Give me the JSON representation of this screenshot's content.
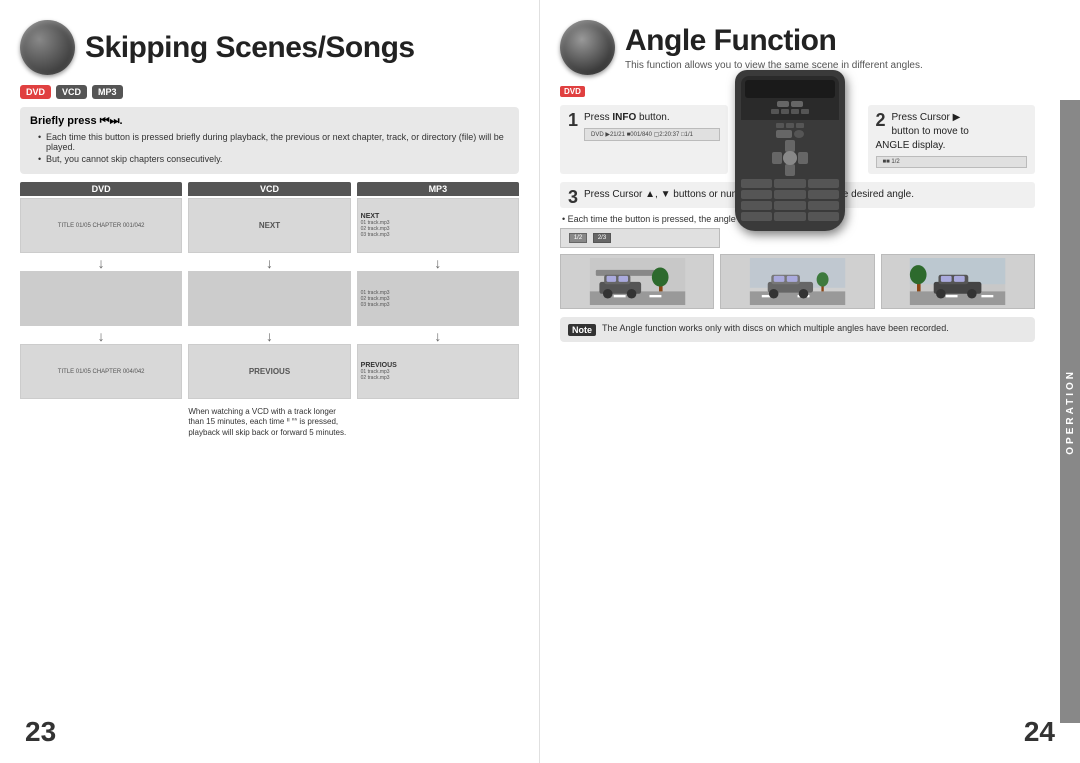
{
  "left_page": {
    "page_number": "23",
    "section_icon_alt": "speaker icon",
    "title": "Skipping Scenes/Songs",
    "format_badges": [
      "DVD",
      "VCD",
      "MP3"
    ],
    "info_box": {
      "title": "Briefly press ᑊ ᑋ.",
      "bullets": [
        "Each time this button is pressed briefly during playback, the previous or next chapter, track, or directory (file) will be played.",
        "But, you cannot skip chapters consecutively."
      ]
    },
    "dvd_col": {
      "label": "DVD",
      "screen1_text": "TITLE 01/05  CHAPTER 001/042",
      "screen2_text": "",
      "screen3_text": "TITLE 01/05  CHAPTER 004/042"
    },
    "vcd_col": {
      "label": "VCD",
      "screen1_text": "NEXT",
      "screen2_text": "",
      "screen3_text": "PREVIOUS"
    },
    "mp3_col": {
      "label": "MP3",
      "screen1_text": "NEXT",
      "screen2_text": "",
      "screen3_text": "PREVIOUS"
    },
    "vcd_note": "When watching a VCD with a track longer than 15 minutes, each time ᑊᑊ ᑋᑋ is pressed, playback will skip back or forward 5 minutes."
  },
  "right_page": {
    "page_number": "24",
    "section_icon_alt": "lens icon",
    "title": "Angle Function",
    "subtitle": "This function allows you to view the same scene in different angles.",
    "format_badge": "DVD",
    "operation_label": "OPERATION",
    "step1": {
      "number": "1",
      "text": "Press INFO button."
    },
    "step2": {
      "number": "2",
      "text": "Press Cursor ▶ button to move to ANGLE display."
    },
    "step3": {
      "number": "3",
      "text": "Press Cursor ▲, ▼ buttons or numeric buttons to select the desired angle."
    },
    "display_row": "DVD  ▶01/01  ⏰01:840  ⏰ 2:20:37  ⎙ 1/1",
    "angle_display_row": "■ 1/2  ■■ 2/3",
    "each_time_note": "Each time the button is pressed, the angle changes as follows:",
    "angle_images": [
      "Car angle 1",
      "Car angle 2",
      "Car angle 3"
    ],
    "note": {
      "label": "Note",
      "text": "The Angle function works only with discs on which multiple angles have been recorded."
    }
  }
}
